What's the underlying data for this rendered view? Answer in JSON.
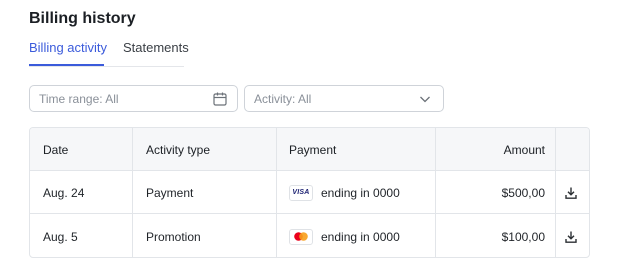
{
  "page": {
    "title": "Billing history"
  },
  "tabs": [
    {
      "label": "Billing activity",
      "active": true
    },
    {
      "label": "Statements",
      "active": false
    }
  ],
  "filters": {
    "time_range": {
      "placeholder": "Time range: All",
      "icon": "calendar-icon"
    },
    "activity": {
      "placeholder": "Activity: All",
      "icon": "chevron-down-icon"
    }
  },
  "table": {
    "columns": [
      "Date",
      "Activity type",
      "Payment",
      "Amount"
    ],
    "rows": [
      {
        "date": "Aug. 24",
        "type": "Payment",
        "card_brand": "VISA",
        "card_icon": "visa-icon",
        "payment": "ending in 0000",
        "amount": "$500,00",
        "action_icon": "download-icon"
      },
      {
        "date": "Aug. 5",
        "type": "Promotion",
        "card_brand": "",
        "card_icon": "mastercard-icon",
        "payment": "ending in 0000",
        "amount": "$100,00",
        "action_icon": "download-icon"
      }
    ]
  },
  "colors": {
    "accent": "#3b5bdb",
    "border": "#e2e5e9",
    "header_bg": "#f6f7f9",
    "mastercard_red": "#eb001b",
    "mastercard_orange": "#f79e1b"
  }
}
